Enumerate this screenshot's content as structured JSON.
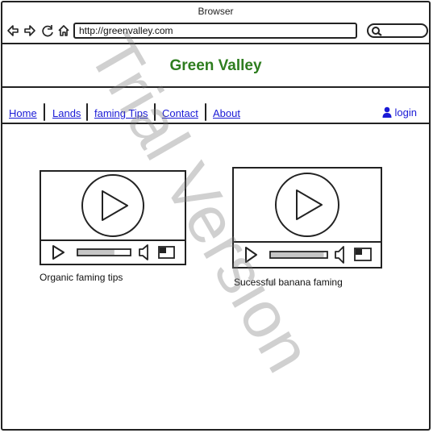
{
  "browser": {
    "title": "Browser",
    "url": "http://greenvalley.com"
  },
  "site": {
    "title": "Green Valley",
    "title_color": "#2e7d1f",
    "link_color": "#1a1ad6"
  },
  "nav": {
    "items": [
      {
        "label": "Home"
      },
      {
        "label": "Lands"
      },
      {
        "label": "faming Tips"
      },
      {
        "label": "Contact"
      },
      {
        "label": "About"
      }
    ],
    "login_label": "login"
  },
  "videos": [
    {
      "caption": "Organic faming tips",
      "progress": 0.7
    },
    {
      "caption": "Sucessful banana faming",
      "progress": 0.95
    }
  ],
  "watermark": "Trial Version"
}
